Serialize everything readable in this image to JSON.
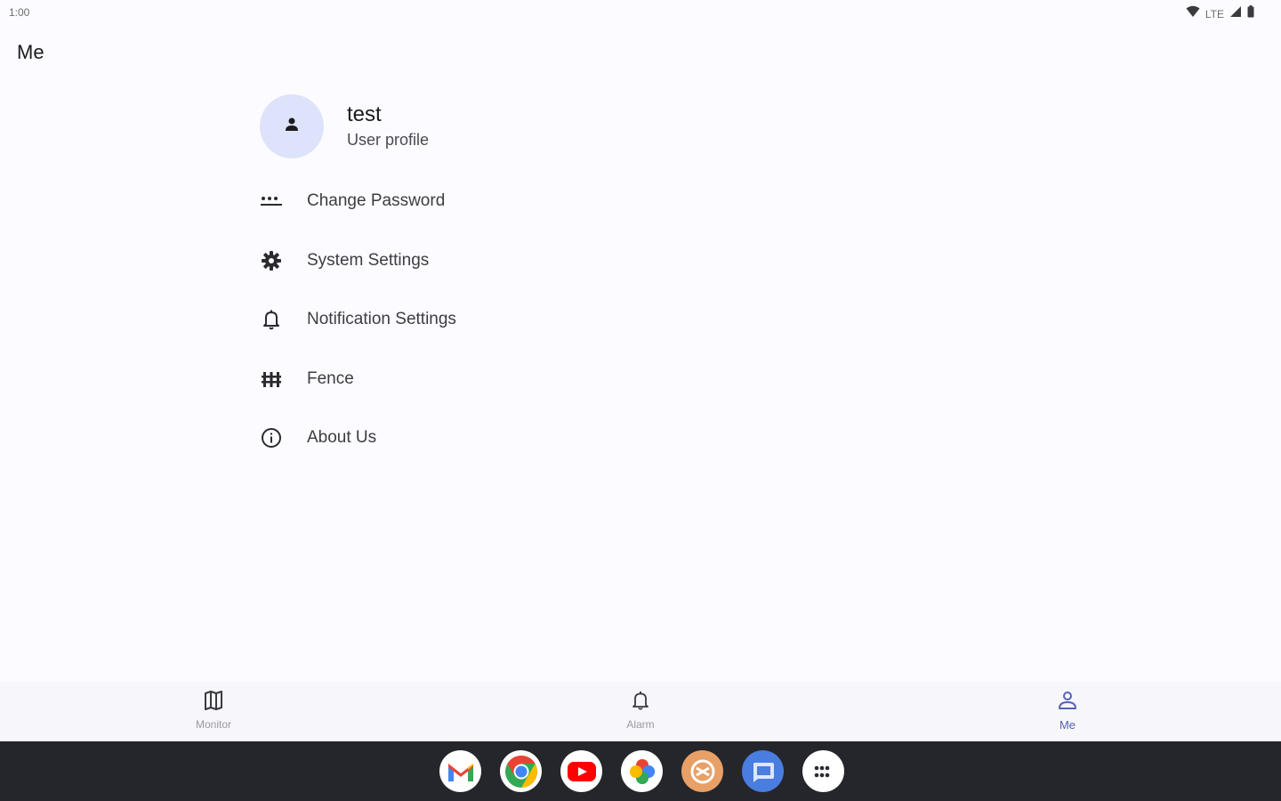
{
  "status_bar": {
    "time": "1:00",
    "network": "LTE",
    "icons": [
      "wifi-icon",
      "signal-icon",
      "battery-icon"
    ]
  },
  "header": {
    "title": "Me"
  },
  "profile": {
    "name": "test",
    "subtitle": "User profile",
    "avatar_icon": "person-icon",
    "avatar_color": "#dde3fb"
  },
  "menu": {
    "items": [
      {
        "label": "Change Password",
        "icon": "password-icon"
      },
      {
        "label": "System Settings",
        "icon": "gear-icon"
      },
      {
        "label": "Notification Settings",
        "icon": "bell-icon"
      },
      {
        "label": "Fence",
        "icon": "fence-icon"
      },
      {
        "label": "About Us",
        "icon": "info-icon"
      }
    ]
  },
  "bottom_nav": {
    "items": [
      {
        "label": "Monitor",
        "icon": "map-icon",
        "active": false
      },
      {
        "label": "Alarm",
        "icon": "bell-icon",
        "active": false
      },
      {
        "label": "Me",
        "icon": "person-icon",
        "active": true
      }
    ],
    "active_color": "#5563b0"
  },
  "taskbar": {
    "apps": [
      "gmail-icon",
      "chrome-icon",
      "youtube-icon",
      "photos-icon",
      "app-icon",
      "messages-icon",
      "app-drawer-icon"
    ]
  }
}
